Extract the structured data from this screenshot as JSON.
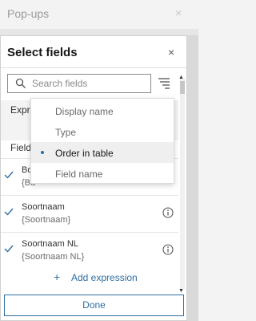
{
  "background": {
    "title": "Pop-ups",
    "close_glyph": "×"
  },
  "panel": {
    "title": "Select fields",
    "close_glyph": "×",
    "search": {
      "placeholder": "Search fields",
      "value": ""
    },
    "expressions_label": "Expre",
    "fields_label": "Field",
    "fields": [
      {
        "name": "Bo",
        "sub": "{Bu",
        "checked": true
      },
      {
        "name": "Soortnaam",
        "sub": "{Soortnaam}",
        "checked": true
      },
      {
        "name": "Soortnaam NL",
        "sub": "{Soortnaam NL}",
        "checked": true
      }
    ],
    "add_expression_label": "Add expression",
    "done_label": "Done"
  },
  "sort_menu": {
    "items": [
      {
        "label": "Display name",
        "selected": false
      },
      {
        "label": "Type",
        "selected": false
      },
      {
        "label": "Order in table",
        "selected": true
      },
      {
        "label": "Field name",
        "selected": false
      }
    ]
  },
  "colors": {
    "accent": "#2f6ea0",
    "text": "#323232",
    "muted": "#6a6a6a"
  },
  "icons": [
    "search-icon",
    "sort-icon",
    "close-icon",
    "check-icon",
    "info-icon",
    "plus-icon"
  ]
}
